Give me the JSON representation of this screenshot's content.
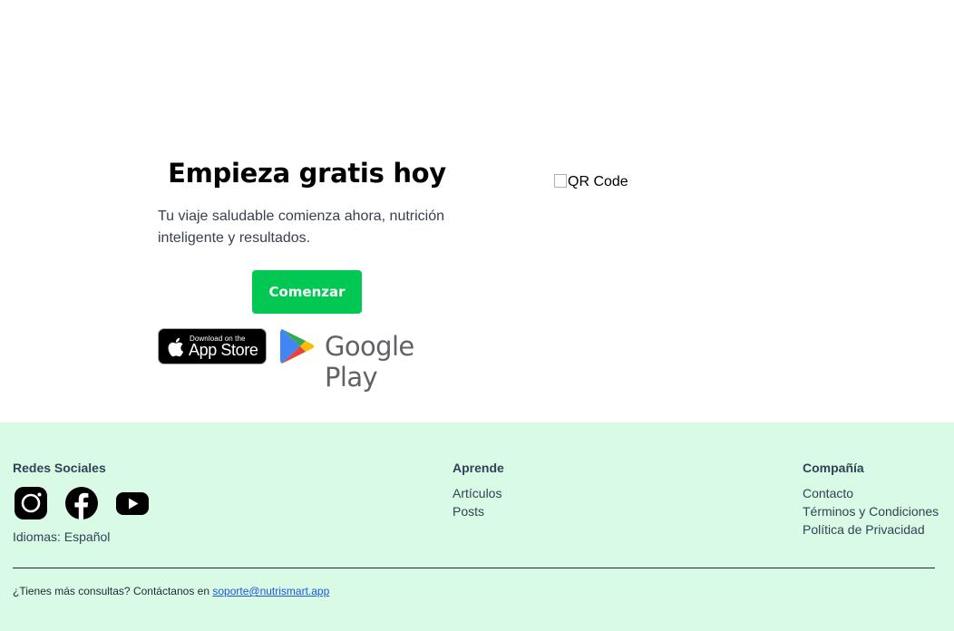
{
  "hero": {
    "title": "Empieza gratis hoy",
    "description": "Tu viaje saludable comienza ahora, nutrición inteligente y resultados.",
    "cta_label": "Comenzar",
    "cta_color": "#00c853",
    "app_store": {
      "small_text": "Download on the",
      "big_text": "App Store"
    },
    "google_play": {
      "text": "Google Play"
    },
    "qr_alt": "QR Code"
  },
  "footer": {
    "background": "#d9fbe6",
    "social": {
      "heading": "Redes Sociales",
      "icons": [
        "instagram-icon",
        "facebook-icon",
        "youtube-icon"
      ],
      "language": "Idiomas: Español"
    },
    "learn": {
      "heading": "Aprende",
      "links": [
        "Artículos",
        "Posts"
      ]
    },
    "company": {
      "heading": "Compañía",
      "links": [
        "Contacto",
        "Términos y Condiciones",
        "Política de Privacidad"
      ]
    },
    "contact_text": "¿Tienes más consultas? Contáctanos en",
    "contact_email": "soporte@nutrismart.app"
  }
}
